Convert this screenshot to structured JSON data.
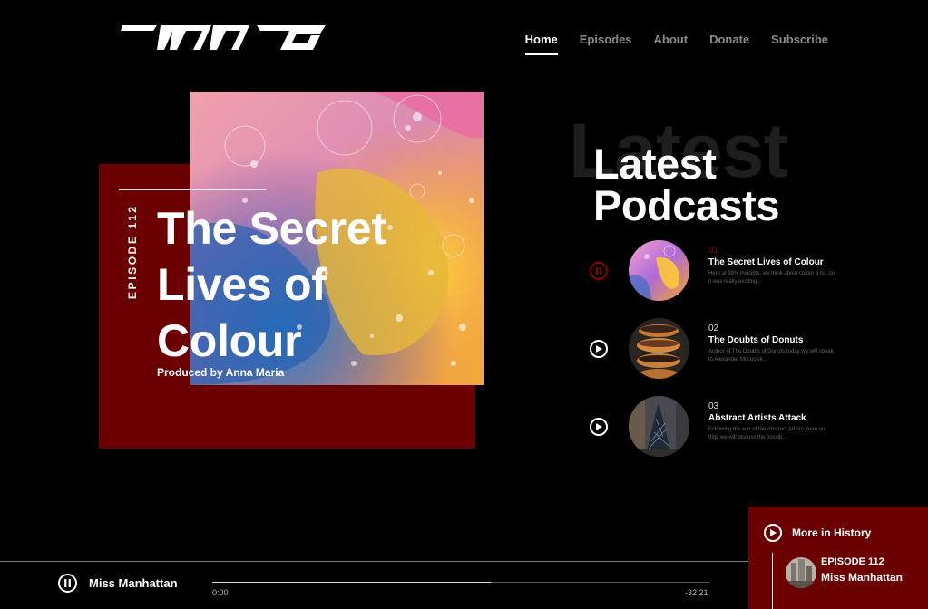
{
  "header": {
    "logo_text": "IMG",
    "nav": [
      {
        "label": "Home",
        "active": true
      },
      {
        "label": "Episodes",
        "active": false
      },
      {
        "label": "About",
        "active": false
      },
      {
        "label": "Donate",
        "active": false
      },
      {
        "label": "Subscribe",
        "active": false
      }
    ]
  },
  "hero": {
    "episode_label": "EPISODE 112",
    "title": "The Secret Lives of Colour",
    "byline": "Produced by Anna Maria"
  },
  "latest": {
    "ghost": "Latest",
    "heading_line1": "Latest",
    "heading_line2": "Podcasts",
    "items": [
      {
        "num": "01",
        "title": "The Secret Lives of Colour",
        "desc": "Here at 99% invisible, we think about colour a lot, so it was really exciting...",
        "playing": true,
        "icon": "pause-icon"
      },
      {
        "num": "02",
        "title": "The Doubts of Donuts",
        "desc": "Author of The Doubts of Donuts today we will speak to Alexander Mitcoolsk...",
        "playing": false,
        "icon": "play-icon"
      },
      {
        "num": "03",
        "title": "Abstract Artists Attack",
        "desc": "Following the war of the Abstract Artists, here on 99pi we will discuss the possib...",
        "playing": false,
        "icon": "play-icon"
      }
    ]
  },
  "player": {
    "track": "Miss Manhattan",
    "elapsed": "0:00",
    "remaining": "-32:21",
    "progress": 0.56
  },
  "history": {
    "label": "More in History",
    "episode": "EPISODE 112",
    "title": "Miss Manhattan"
  },
  "colors": {
    "accent": "#6b0000",
    "accent_bright": "#8b0000",
    "background": "#000000"
  }
}
